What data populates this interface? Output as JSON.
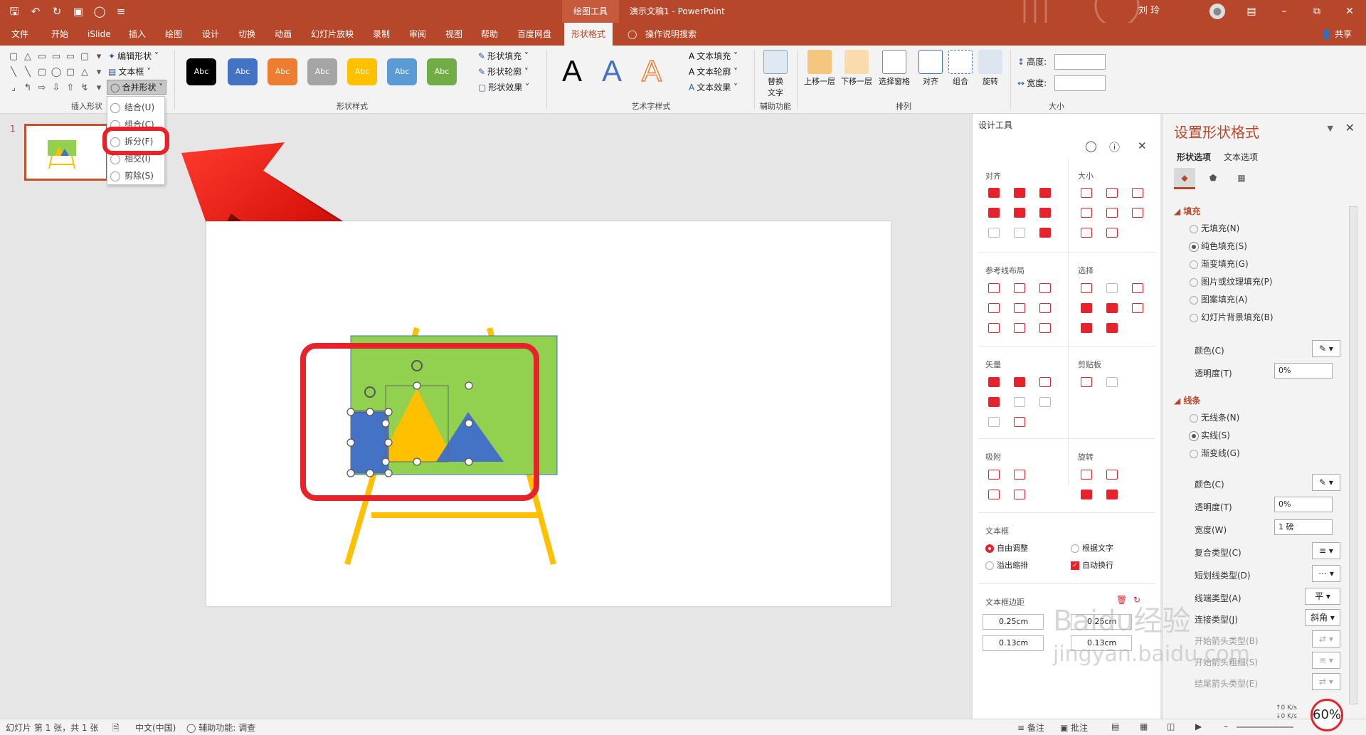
{
  "titlebar": {
    "context_tools": "绘图工具",
    "doc_title": "演示文稿1  -  PowerPoint",
    "user": "刘 玲"
  },
  "tabs": [
    "文件",
    "开始",
    "iSlide",
    "插入",
    "绘图",
    "设计",
    "切换",
    "动画",
    "幻灯片放映",
    "录制",
    "审阅",
    "视图",
    "帮助",
    "百度网盘",
    "形状格式"
  ],
  "tell_me": "操作说明搜索",
  "share": "共享",
  "ribbon": {
    "insert_shapes": {
      "edit_shape": "编辑形状",
      "text_box": "文本框",
      "merge_shapes": "合并形状",
      "label": "插入形状"
    },
    "shape_styles": {
      "style_label": "Abc",
      "styles": [
        {
          "color": "#000000"
        },
        {
          "color": "#4472c4"
        },
        {
          "color": "#ed7d31"
        },
        {
          "color": "#a5a5a5"
        },
        {
          "color": "#ffc000"
        },
        {
          "color": "#5b9bd5"
        },
        {
          "color": "#70ad47"
        }
      ],
      "fill": "形状填充",
      "outline": "形状轮廓",
      "effects": "形状效果",
      "label": "形状样式"
    },
    "wordart": {
      "letter": "A",
      "text_fill": "文本填充",
      "text_outline": "文本轮廓",
      "text_effects": "文本效果",
      "label": "艺术字样式"
    },
    "accessibility": {
      "alt_text_1": "替换",
      "alt_text_2": "文字",
      "label": "辅助功能"
    },
    "arrange": {
      "bring_forward": "上移一层",
      "send_backward": "下移一层",
      "selection_pane": "选择窗格",
      "align": "对齐",
      "group": "组合",
      "rotate": "旋转",
      "label": "排列"
    },
    "size": {
      "height": "高度:",
      "width": "宽度:",
      "label": "大小"
    }
  },
  "merge_menu": [
    {
      "label": "结合(U)"
    },
    {
      "label": "组合(C)"
    },
    {
      "label": "拆分(F)"
    },
    {
      "label": "相交(I)"
    },
    {
      "label": "剪除(S)"
    }
  ],
  "thumbnail": {
    "number": "1"
  },
  "design_panel": {
    "title": "设计工具",
    "sections": {
      "align": "对齐",
      "size": "大小",
      "guides": "参考线布局",
      "select": "选择",
      "vector": "矢量",
      "clipboard": "剪贴板",
      "snap": "吸附",
      "rotate": "旋转",
      "textbox": "文本框",
      "margin": "文本框边距"
    },
    "textbox_opts": {
      "auto_adjust": "自由调整",
      "by_text": "根据文字",
      "overflow": "溢出缩排",
      "auto_wrap": "自动换行"
    },
    "margins": {
      "left": "0.25cm",
      "right": "0.25cm",
      "top": "0.13cm",
      "bottom": "0.13cm"
    }
  },
  "format_pane": {
    "title": "设置形状格式",
    "tab_shape": "形状选项",
    "tab_text": "文本选项",
    "fill_section": "填充",
    "fill_options": [
      "无填充(N)",
      "纯色填充(S)",
      "渐变填充(G)",
      "图片或纹理填充(P)",
      "图案填充(A)",
      "幻灯片背景填充(B)"
    ],
    "fill_selected": 1,
    "color_label": "颜色(C)",
    "transparency_label": "透明度(T)",
    "transparency_value": "0%",
    "line_section": "线条",
    "line_options": [
      "无线条(N)",
      "实线(S)",
      "渐变线(G)"
    ],
    "line_selected": 1,
    "line_color_label": "颜色(C)",
    "line_transparency_label": "透明度(T)",
    "line_transparency_value": "0%",
    "width_label": "宽度(W)",
    "width_value": "1 磅",
    "compound_label": "复合类型(C)",
    "dash_label": "短划线类型(D)",
    "cap_label": "线端类型(A)",
    "cap_value": "平",
    "join_label": "连接类型(J)",
    "join_value": "斜角",
    "begin_arrow_label": "开始箭头类型(B)",
    "begin_size_label": "开始箭头粗细(S)",
    "end_arrow_label": "结尾箭头类型(E)"
  },
  "statusbar": {
    "slide_info": "幻灯片 第 1 张，共 1 张",
    "language": "中文(中国)",
    "accessibility": "辅助功能: 调查",
    "notes": "备注",
    "comments": "批注"
  },
  "zoom": "60%",
  "net_speed": {
    "up": "0  K/s",
    "down": "0  K/s"
  },
  "watermark": {
    "main": "Baidu经验",
    "sub": "jingyan.baidu.com"
  }
}
